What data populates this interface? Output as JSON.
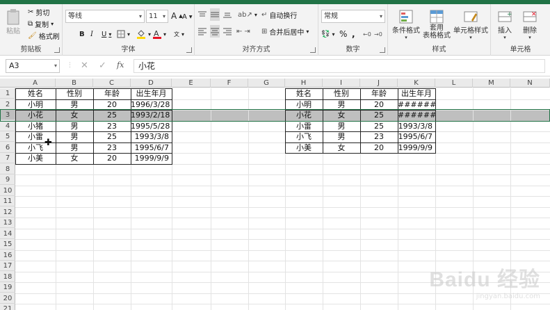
{
  "ribbon": {
    "clipboard": {
      "paste": "粘贴",
      "cut": "剪切",
      "copy": "复制",
      "format_painter": "格式刷",
      "label": "剪贴板"
    },
    "font": {
      "name": "等线",
      "size": "11",
      "bold": "B",
      "italic": "I",
      "underline": "U",
      "grow": "A",
      "shrink": "A",
      "label": "字体"
    },
    "alignment": {
      "wrap": "自动换行",
      "merge": "合并后居中",
      "label": "对齐方式"
    },
    "number": {
      "format": "常规",
      "percent": "%",
      "comma": ",",
      "label": "数字"
    },
    "styles": {
      "conditional": "条件格式",
      "table": "套用\n表格格式",
      "cell": "单元格样式",
      "label": "样式"
    },
    "cells": {
      "insert": "插入",
      "delete": "删除",
      "label": "单元格"
    }
  },
  "formula_bar": {
    "namebox": "A3",
    "fx": "fx",
    "value": "小花"
  },
  "columns": [
    "A",
    "B",
    "C",
    "D",
    "E",
    "F",
    "G",
    "H",
    "I",
    "J",
    "K",
    "L",
    "M",
    "N"
  ],
  "rows": [
    "1",
    "2",
    "3",
    "4",
    "5",
    "6",
    "7",
    "8",
    "9",
    "10",
    "11",
    "12",
    "13",
    "14",
    "15",
    "16",
    "17",
    "18",
    "19",
    "20",
    "21"
  ],
  "table1": {
    "header": [
      "姓名",
      "性别",
      "年龄",
      "出生年月"
    ],
    "rows": [
      [
        "小明",
        "男",
        "20",
        "1996/3/28"
      ],
      [
        "小花",
        "女",
        "25",
        "1993/2/18"
      ],
      [
        "小猪",
        "男",
        "23",
        "1995/5/28"
      ],
      [
        "小雷",
        "男",
        "25",
        "1993/3/8"
      ],
      [
        "小飞",
        "男",
        "23",
        "1995/6/7"
      ],
      [
        "小美",
        "女",
        "20",
        "1999/9/9"
      ]
    ]
  },
  "table2": {
    "header": [
      "姓名",
      "性别",
      "年龄",
      "出生年月"
    ],
    "rows": [
      [
        "小明",
        "男",
        "20",
        "#######"
      ],
      [
        "小花",
        "女",
        "25",
        "#######"
      ],
      [
        "小雷",
        "男",
        "25",
        "1993/3/8"
      ],
      [
        "小飞",
        "男",
        "23",
        "1995/6/7"
      ],
      [
        "小美",
        "女",
        "20",
        "1999/9/9"
      ]
    ]
  },
  "watermark": {
    "logo": "Baidu 经验",
    "url": "jingyan.baidu.com"
  },
  "colors": {
    "accent": "#217346",
    "selected_row": "#bfbfbf",
    "font_color_bar": "#e81123",
    "fill_color_bar": "#ffd700"
  }
}
